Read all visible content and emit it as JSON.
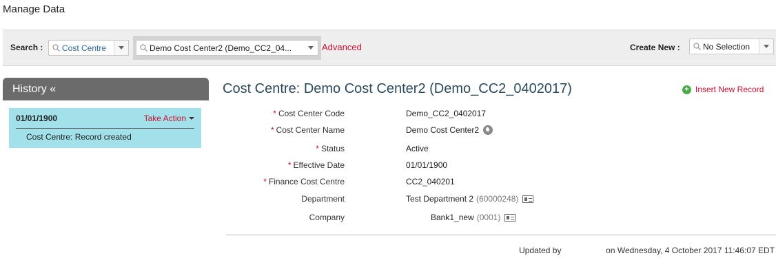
{
  "page": {
    "title": "Manage Data"
  },
  "search": {
    "label": "Search :",
    "type_value": "Cost Centre",
    "record_value": "Demo Cost Center2 (Demo_CC2_04...",
    "advanced_link": "Advanced",
    "create_label": "Create New :",
    "create_value": "No Selection"
  },
  "history": {
    "header": "History «",
    "entries": [
      {
        "date": "01/01/1900",
        "action": "Take Action",
        "note": "Cost Centre: Record created"
      }
    ]
  },
  "record": {
    "title": "Cost Centre: Demo Cost Center2 (Demo_CC2_0402017)",
    "insert_new": "Insert New Record",
    "fields": [
      {
        "label": "Cost Center Code",
        "required": true,
        "value": "Demo_CC2_0402017"
      },
      {
        "label": "Cost Center Name",
        "required": true,
        "value": "Demo Cost Center2"
      },
      {
        "label": "Status",
        "required": true,
        "value": "Active"
      },
      {
        "label": "Effective Date",
        "required": true,
        "value": "01/01/1900"
      },
      {
        "label": "Finance Cost Centre",
        "required": true,
        "value": "CC2_040201"
      },
      {
        "label": "Department",
        "required": false,
        "value": "Test Department 2",
        "code": "(60000248)"
      },
      {
        "label": "Company",
        "required": false,
        "value": "Bank1_new",
        "code": "(0001)"
      }
    ],
    "required_marker": "*"
  },
  "footer": {
    "updated_prefix": "Updated by",
    "updated_suffix": "on Wednesday, 4 October 2017 11:46:07 EDT"
  },
  "colors": {
    "accent_red": "#c8102e",
    "history_card": "#a2e1ea",
    "history_header": "#6b6b6b",
    "title_blue": "#2c4a5e"
  }
}
